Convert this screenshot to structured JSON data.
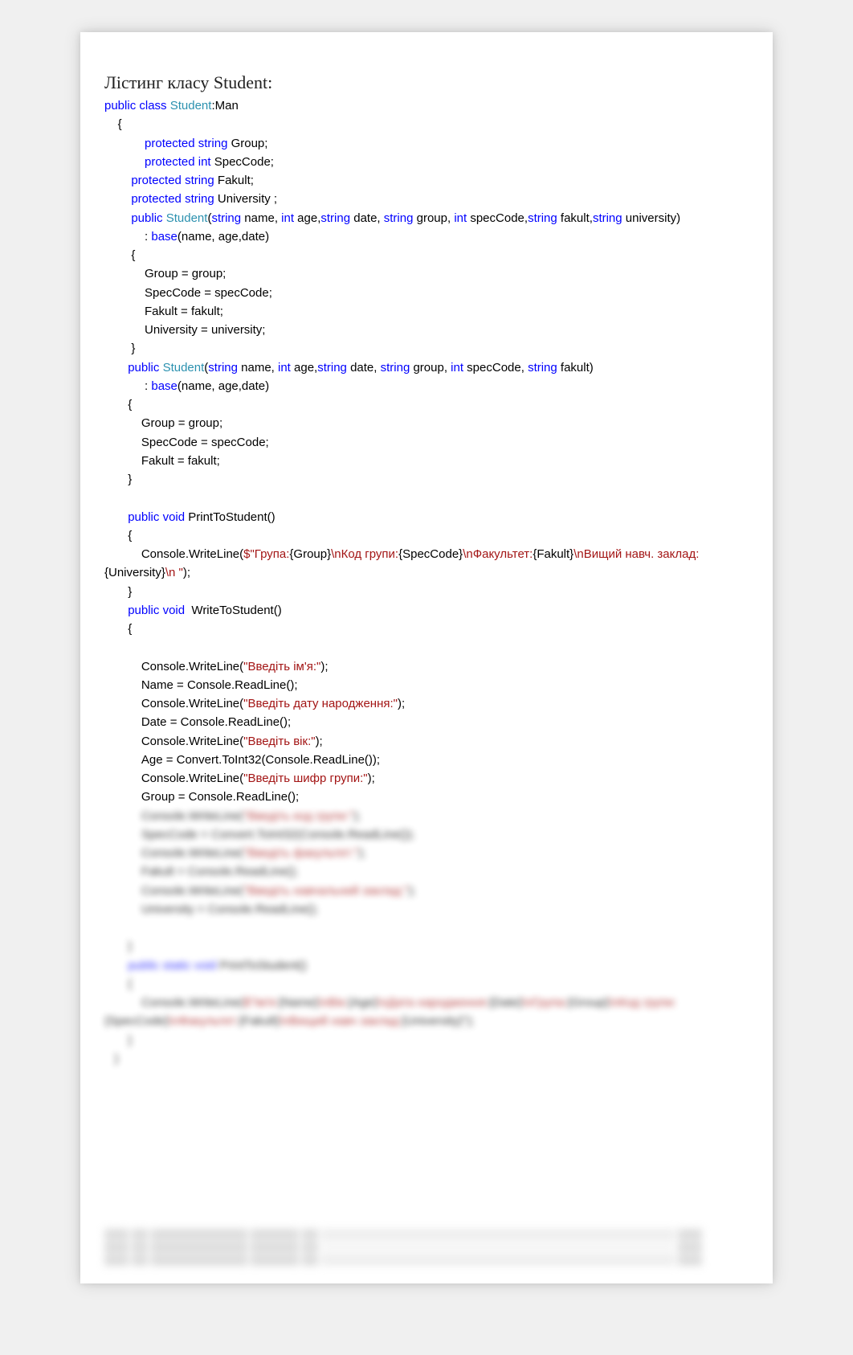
{
  "title": "Лістинг класу Student:",
  "code": {
    "l1a": "public",
    "l1b": "class",
    "l1c": "Student",
    "l1d": ":Man",
    "l2": "    {",
    "l3a": "            protected",
    "l3b": "string",
    "l3c": " Group;",
    "l4a": "            protected",
    "l4b": "int",
    "l4c": " SpecCode;",
    "l5a": "        protected",
    "l5b": "string",
    "l5c": " Fakult;",
    "l6a": "        protected",
    "l6b": "string",
    "l6c": " University ;",
    "l7a": "        public",
    "l7b": "Student",
    "l7c": "(",
    "l7d": "string",
    "l7e": " name, ",
    "l7f": "int",
    "l7g": " age,",
    "l7h": "string",
    "l7i": " date, ",
    "l7j": "string",
    "l7k": " group, ",
    "l7l": "int",
    "l7m": " specCode,",
    "l7n": "string",
    "l7o": " fakult,",
    "l7p": "string",
    "l7q": " university)",
    "l8a": "            : ",
    "l8b": "base",
    "l8c": "(name, age,date)",
    "l9": "        {",
    "l10": "            Group = group;",
    "l11": "            SpecCode = specCode;",
    "l12": "            Fakult = fakult;",
    "l13": "            University = university;",
    "l14": "        }",
    "l15a": "       public",
    "l15b": "Student",
    "l15c": "(",
    "l15d": "string",
    "l15e": " name, ",
    "l15f": "int",
    "l15g": " age,",
    "l15h": "string",
    "l15i": " date, ",
    "l15j": "string",
    "l15k": " group, ",
    "l15l": "int",
    "l15m": " specCode, ",
    "l15n": "string",
    "l15o": " fakult)",
    "l16a": "            : ",
    "l16b": "base",
    "l16c": "(name, age,date)",
    "l17": "       {",
    "l18": "           Group = group;",
    "l19": "           SpecCode = specCode;",
    "l20": "           Fakult = fakult;",
    "l21": "       }",
    "l22": "",
    "l23a": "       public",
    "l23b": "void",
    "l23c": " PrintToStudent()",
    "l24": "       {",
    "l25a": "           Console.WriteLine(",
    "l25b": "$\"Група:",
    "l25c": "{Group}",
    "l25d": "\\nКод групи:",
    "l25e": "{SpecCode}",
    "l25f": "\\nФакультет:",
    "l25g": "{Fakult}",
    "l25h": "\\nВищий навч. заклад:",
    "l25i": "{University}",
    "l25j": "\\n \"",
    "l25k": ");",
    "l26": "       }",
    "l27a": "       public",
    "l27b": "void",
    "l27c": "  WriteToStudent()",
    "l28": "       {",
    "l29": "",
    "l30a": "           Console.WriteLine(",
    "l30b": "\"Введіть ім'я:\"",
    "l30c": ");",
    "l31": "           Name = Console.ReadLine();",
    "l32a": "           Console.WriteLine(",
    "l32b": "\"Введіть дату народження:\"",
    "l32c": ");",
    "l33": "           Date = Console.ReadLine();",
    "l34a": "           Console.WriteLine(",
    "l34b": "\"Введіть вік:\"",
    "l34c": ");",
    "l35": "           Age = Convert.ToInt32(Console.ReadLine());",
    "l36a": "           Console.WriteLine(",
    "l36b": "\"Введіть шифр групи:\"",
    "l36c": ");",
    "l37": "           Group = Console.ReadLine();",
    "blur1a": "           Console.WriteLine(",
    "blur1b": "\"Введіть код групи:\"",
    "blur1c": ");",
    "blur2": "           SpecCode = Convert.ToInt32(Console.ReadLine());",
    "blur3a": "           Console.WriteLine(",
    "blur3b": "\"Введіть факультет:\"",
    "blur3c": ");",
    "blur4": "           Fakult = Console.ReadLine();",
    "blur5a": "           Console.WriteLine(",
    "blur5b": "\"Введіть навчальний заклад:\"",
    "blur5c": ");",
    "blur6": "           University = Console.ReadLine();",
    "blur7": "       }",
    "blur8a": "       public",
    "blur8b": " static",
    "blur8c": " void",
    "blur8d": " PrintToStudent()",
    "blur9": "       {",
    "blur10a": "           Console.WriteLine(",
    "blur10b": "$\"Ім'я:",
    "blur10c": "{Name}",
    "blur10d": "\\nВік:",
    "blur10e": "{Age}",
    "blur10f": "\\nДата народження:",
    "blur10g": "{Date}",
    "blur10h": "\\nГрупа:",
    "blur10i": "{Group}",
    "blur10j": "\\nКод групи:",
    "blur10k": "{SpecCode}",
    "blur10l": "\\nФакультет:",
    "blur10m": "{Fakult}",
    "blur10n": "\\nВищий навч заклад:",
    "blur10o": "{University}\"",
    "blur10p": ");",
    "blur11": "       }",
    "blur12": "   }"
  }
}
